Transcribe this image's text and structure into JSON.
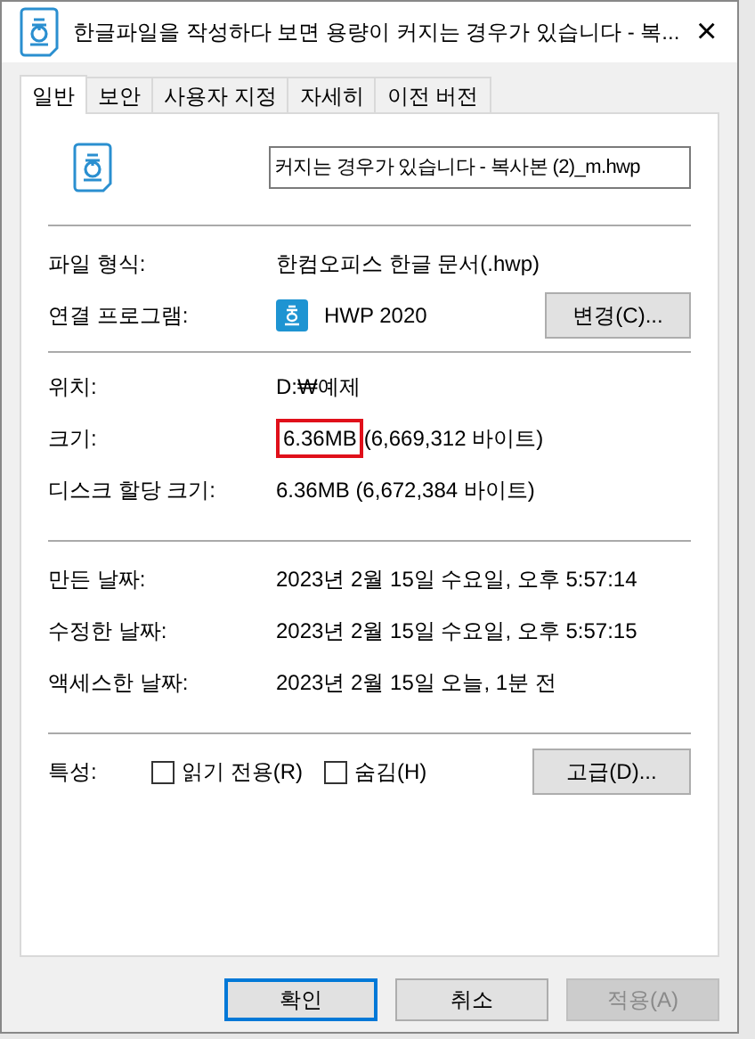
{
  "window": {
    "title": "한글파일을 작성하다 보면 용량이 커지는 경우가 있습니다 - 복...",
    "close": "×"
  },
  "tabs": [
    {
      "label": "일반",
      "selected": true
    },
    {
      "label": "보안",
      "selected": false
    },
    {
      "label": "사용자 지정",
      "selected": false
    },
    {
      "label": "자세히",
      "selected": false
    },
    {
      "label": "이전 버전",
      "selected": false
    }
  ],
  "file_name": {
    "value": "커지는 경우가 있습니다 - 복사본 (2)_m.hwp"
  },
  "file_info": [
    {
      "label": "파일 형식:",
      "value": "한컴오피스 한글 문서(.hwp)"
    },
    {
      "label": "연결 프로그램:",
      "value": "HWP 2020",
      "button": "변경(C)..."
    }
  ],
  "location_info": [
    {
      "label": "위치:",
      "value": "D:₩예제",
      "highlighted": false
    },
    {
      "label": "크기:",
      "value": "6.36MB",
      "value_suffix": "(6,669,312 바이트)",
      "highlighted": true
    },
    {
      "label": "디스크 할당 크기:",
      "value": "6.36MB (6,672,384 바이트)",
      "highlighted": false
    }
  ],
  "dates": [
    {
      "label": "만든 날짜:",
      "value": "2023년 2월 15일 수요일, 오후 5:57:14"
    },
    {
      "label": "수정한 날짜:",
      "value": "2023년 2월 15일 수요일, 오후 5:57:15"
    },
    {
      "label": "액세스한 날짜:",
      "value": "2023년 2월 15일 오늘, 1분 전"
    }
  ],
  "attributes": {
    "label": "특성:",
    "checkboxes": [
      {
        "label": "읽기 전용(R)",
        "checked": false
      },
      {
        "label": "숨김(H)",
        "checked": false
      }
    ],
    "button": "고급(D)..."
  },
  "buttons": [
    {
      "label": "확인",
      "default": true,
      "disabled": false
    },
    {
      "label": "취소",
      "default": false,
      "disabled": false
    },
    {
      "label": "적용(A)",
      "default": false,
      "disabled": true
    }
  ]
}
